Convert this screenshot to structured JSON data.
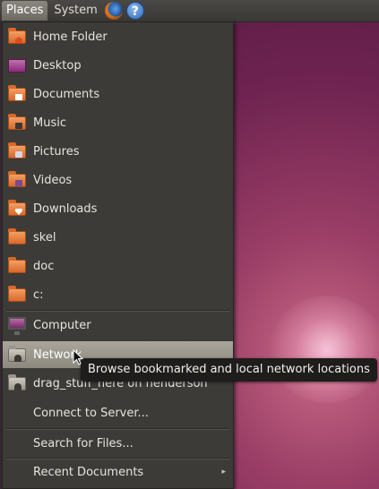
{
  "panel": {
    "places_label": "Places",
    "system_label": "System",
    "help_glyph": "?",
    "launchers": [
      "firefox-icon",
      "help-icon"
    ]
  },
  "menu": {
    "items": [
      {
        "label": "Home Folder",
        "icon": "home-folder-icon"
      },
      {
        "label": "Desktop",
        "icon": "desktop-icon"
      },
      {
        "label": "Documents",
        "icon": "documents-folder-icon"
      },
      {
        "label": "Music",
        "icon": "music-folder-icon"
      },
      {
        "label": "Pictures",
        "icon": "pictures-folder-icon"
      },
      {
        "label": "Videos",
        "icon": "videos-folder-icon"
      },
      {
        "label": "Downloads",
        "icon": "downloads-folder-icon"
      },
      {
        "label": "skel",
        "icon": "folder-icon"
      },
      {
        "label": "doc",
        "icon": "folder-icon"
      },
      {
        "label": "c:",
        "icon": "folder-icon"
      },
      {
        "label": "Computer",
        "icon": "computer-icon"
      },
      {
        "label": "Network",
        "icon": "network-icon"
      },
      {
        "label": "drag_stuff_here on henderson",
        "icon": "network-share-icon"
      },
      {
        "label": "Connect to Server..."
      },
      {
        "label": "Search for Files..."
      },
      {
        "label": "Recent Documents"
      }
    ],
    "highlighted": "Network",
    "submenu_arrow": "▸"
  },
  "tooltip": {
    "text": "Browse bookmarked and local network locations"
  },
  "colors": {
    "menu_bg": "#3c3b37",
    "highlight": "#a9a59b",
    "folder_orange": "#d9682a",
    "wallpaper": "#6e2350"
  }
}
